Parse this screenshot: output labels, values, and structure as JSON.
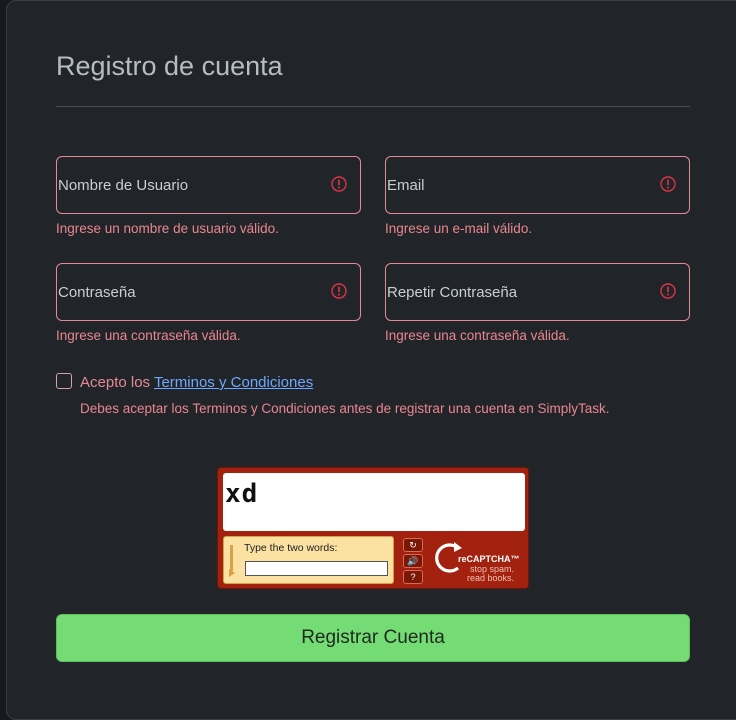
{
  "form": {
    "title": "Registro de cuenta",
    "fields": [
      {
        "label": "Nombre de Usuario",
        "feedback": "Ingrese un nombre de usuario válido."
      },
      {
        "label": "Email",
        "feedback": "Ingrese un e-mail válido."
      },
      {
        "label": "Contraseña",
        "feedback": "Ingrese una contraseña válida."
      },
      {
        "label": "Repetir Contraseña",
        "feedback": "Ingrese una contraseña válida."
      }
    ],
    "terms": {
      "prefix": "Acepto los ",
      "link": "Terminos y Condiciones",
      "feedback": "Debes aceptar los Terminos y Condiciones antes de registrar una cuenta en SimplyTask."
    },
    "submit_label": "Registrar Cuenta"
  },
  "captcha": {
    "challenge_text": "xd",
    "prompt": "Type the two words:",
    "brand": "reCAPTCHA™",
    "tagline": [
      "stop spam.",
      "read books."
    ],
    "controls": {
      "reload": "↻",
      "audio": "🔊",
      "help": "?"
    }
  },
  "colors": {
    "invalid": "#ea868f",
    "link": "#6ea8fe",
    "submit": "#75dc75",
    "captcha_red": "#a3210f"
  }
}
